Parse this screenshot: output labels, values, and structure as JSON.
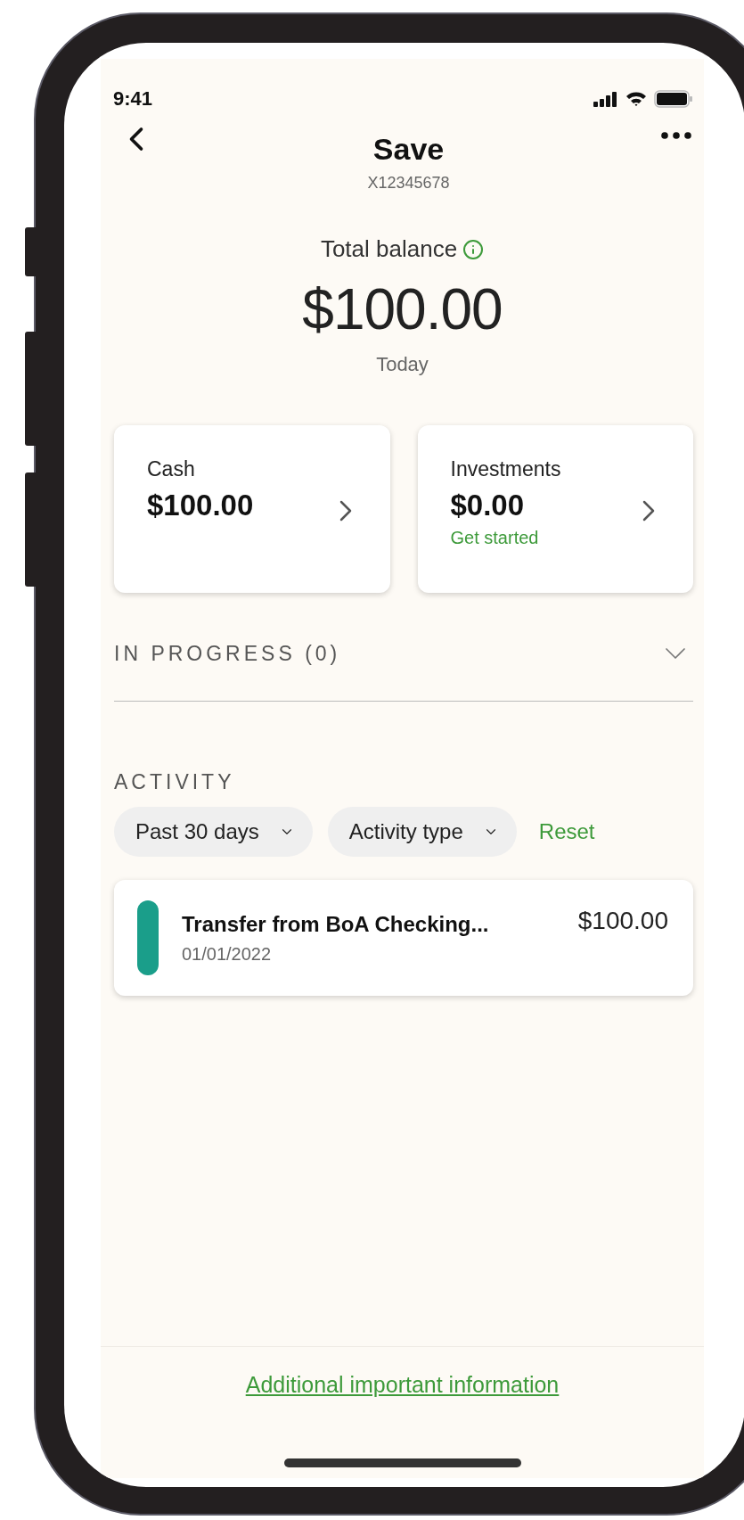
{
  "status_bar": {
    "time": "9:41"
  },
  "header": {
    "title": "Save",
    "account_number": "X12345678"
  },
  "balance": {
    "label": "Total balance",
    "amount": "$100.00",
    "date": "Today"
  },
  "cards": [
    {
      "label": "Cash",
      "amount": "$100.00"
    },
    {
      "label": "Investments",
      "amount": "$0.00",
      "link": "Get started"
    }
  ],
  "in_progress": {
    "label": "IN PROGRESS (0)",
    "expanded": false
  },
  "activity": {
    "heading": "ACTIVITY",
    "filters": [
      {
        "label": "Past 30 days"
      },
      {
        "label": "Activity type"
      }
    ],
    "reset": "Reset",
    "transactions": [
      {
        "title": "Transfer from BoA Checking...",
        "date": "01/01/2022",
        "amount": "$100.00",
        "color": "#1a9e8a"
      }
    ]
  },
  "footer": {
    "link": "Additional important information"
  }
}
